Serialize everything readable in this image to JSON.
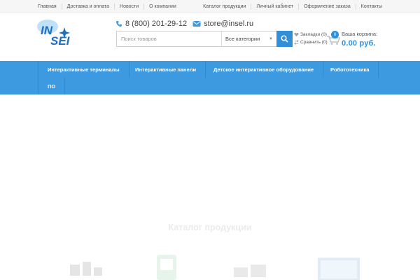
{
  "topbar": {
    "left_links": [
      "Главная",
      "Доставка и оплата",
      "Новости",
      "О компании"
    ],
    "right_links": [
      "Каталог продукции",
      "Личный кабинет",
      "Оформление заказа",
      "Контакты"
    ]
  },
  "header": {
    "logo_text": "INSEI",
    "phone": "8 (800) 201-29-12",
    "email": "store@insel.ru",
    "phone_icon": "phone-icon",
    "email_icon": "envelope-icon"
  },
  "search": {
    "placeholder": "Поиск товаров",
    "value": "",
    "category_selected": "Все категории",
    "button_icon": "search-icon"
  },
  "user": {
    "bookmarks": "Закладки (0)",
    "compare": "Сравнить (0)"
  },
  "cart": {
    "count": "0",
    "label": "Ваша корзина:",
    "total": "0.00  руб."
  },
  "nav": {
    "items": [
      "Интерактивные терминалы",
      "Интерактивные панели",
      "Детское интерактивное оборудование",
      "Робототехника",
      "ПО"
    ]
  },
  "catalog": {
    "title": "Каталог продукции"
  },
  "colors": {
    "accent": "#3d99e0",
    "button": "#2f8fd9",
    "topbar": "#f6f6f6"
  }
}
